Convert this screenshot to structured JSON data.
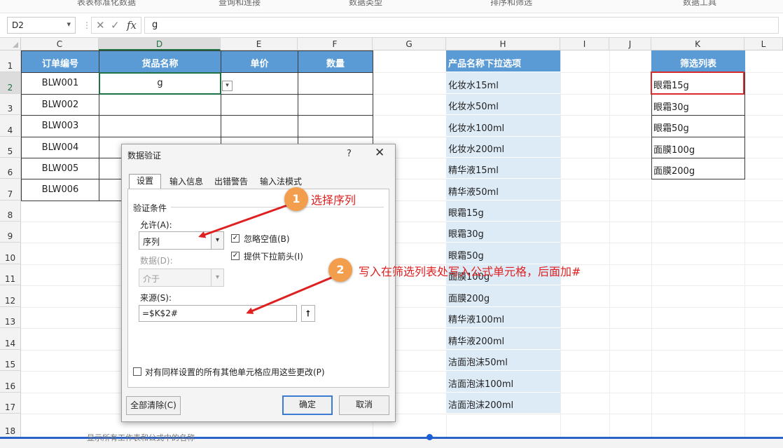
{
  "top_strip": [
    "表表标准化数据",
    "查询和连接",
    "数据类型",
    "排序和筛选",
    "数据工具"
  ],
  "formula_bar": {
    "name_box": "D2",
    "formula": "g"
  },
  "columns": [
    "C",
    "D",
    "E",
    "F",
    "G",
    "H",
    "I",
    "J",
    "K",
    "L"
  ],
  "rows": [
    "1",
    "2",
    "3",
    "4",
    "5",
    "6",
    "7",
    "8",
    "9",
    "10",
    "11",
    "12",
    "13",
    "14",
    "15",
    "16",
    "17",
    "18"
  ],
  "table": {
    "headers": [
      "订单编号",
      "货品名称",
      "单价",
      "数量"
    ],
    "order_ids": [
      "BLW001",
      "BLW002",
      "BLW003",
      "BLW004",
      "BLW005",
      "BLW006"
    ],
    "d2_value": "g"
  },
  "product_list": {
    "header": "产品名称下拉选项",
    "items": [
      "化妆水15ml",
      "化妆水50ml",
      "化妆水100ml",
      "化妆水200ml",
      "精华液15ml",
      "精华液50ml",
      "眼霜15g",
      "眼霜30g",
      "眼霜50g",
      "面膜100g",
      "面膜200g",
      "精华液100ml",
      "精华液200ml",
      "洁面泡沫50ml",
      "洁面泡沫100ml",
      "洁面泡沫200ml"
    ]
  },
  "filter_list": {
    "header": "筛选列表",
    "items": [
      "眼霜15g",
      "眼霜30g",
      "眼霜50g",
      "面膜100g",
      "面膜200g"
    ]
  },
  "dialog": {
    "title": "数据验证",
    "help": "?",
    "close": "✕",
    "tabs": [
      "设置",
      "输入信息",
      "出错警告",
      "输入法模式"
    ],
    "group_label": "验证条件",
    "allow_label": "允许(A):",
    "allow_value": "序列",
    "ignore_blank": "忽略空值(B)",
    "dropdown": "提供下拉箭头(I)",
    "data_label": "数据(D):",
    "data_value": "介于",
    "source_label": "来源(S):",
    "source_value": "=$K$2#",
    "apply_all": "对有同样设置的所有其他单元格应用这些更改(P)",
    "clear_all": "全部清除(C)",
    "ok": "确定",
    "cancel": "取消"
  },
  "annotations": {
    "step1_num": "1",
    "step1_text": "选择序列",
    "step2_num": "2",
    "step2_text": "写入在筛选列表处写入公式单元格，后面加#"
  },
  "bottom_strip": "显示所有工作表和公式中的名称"
}
